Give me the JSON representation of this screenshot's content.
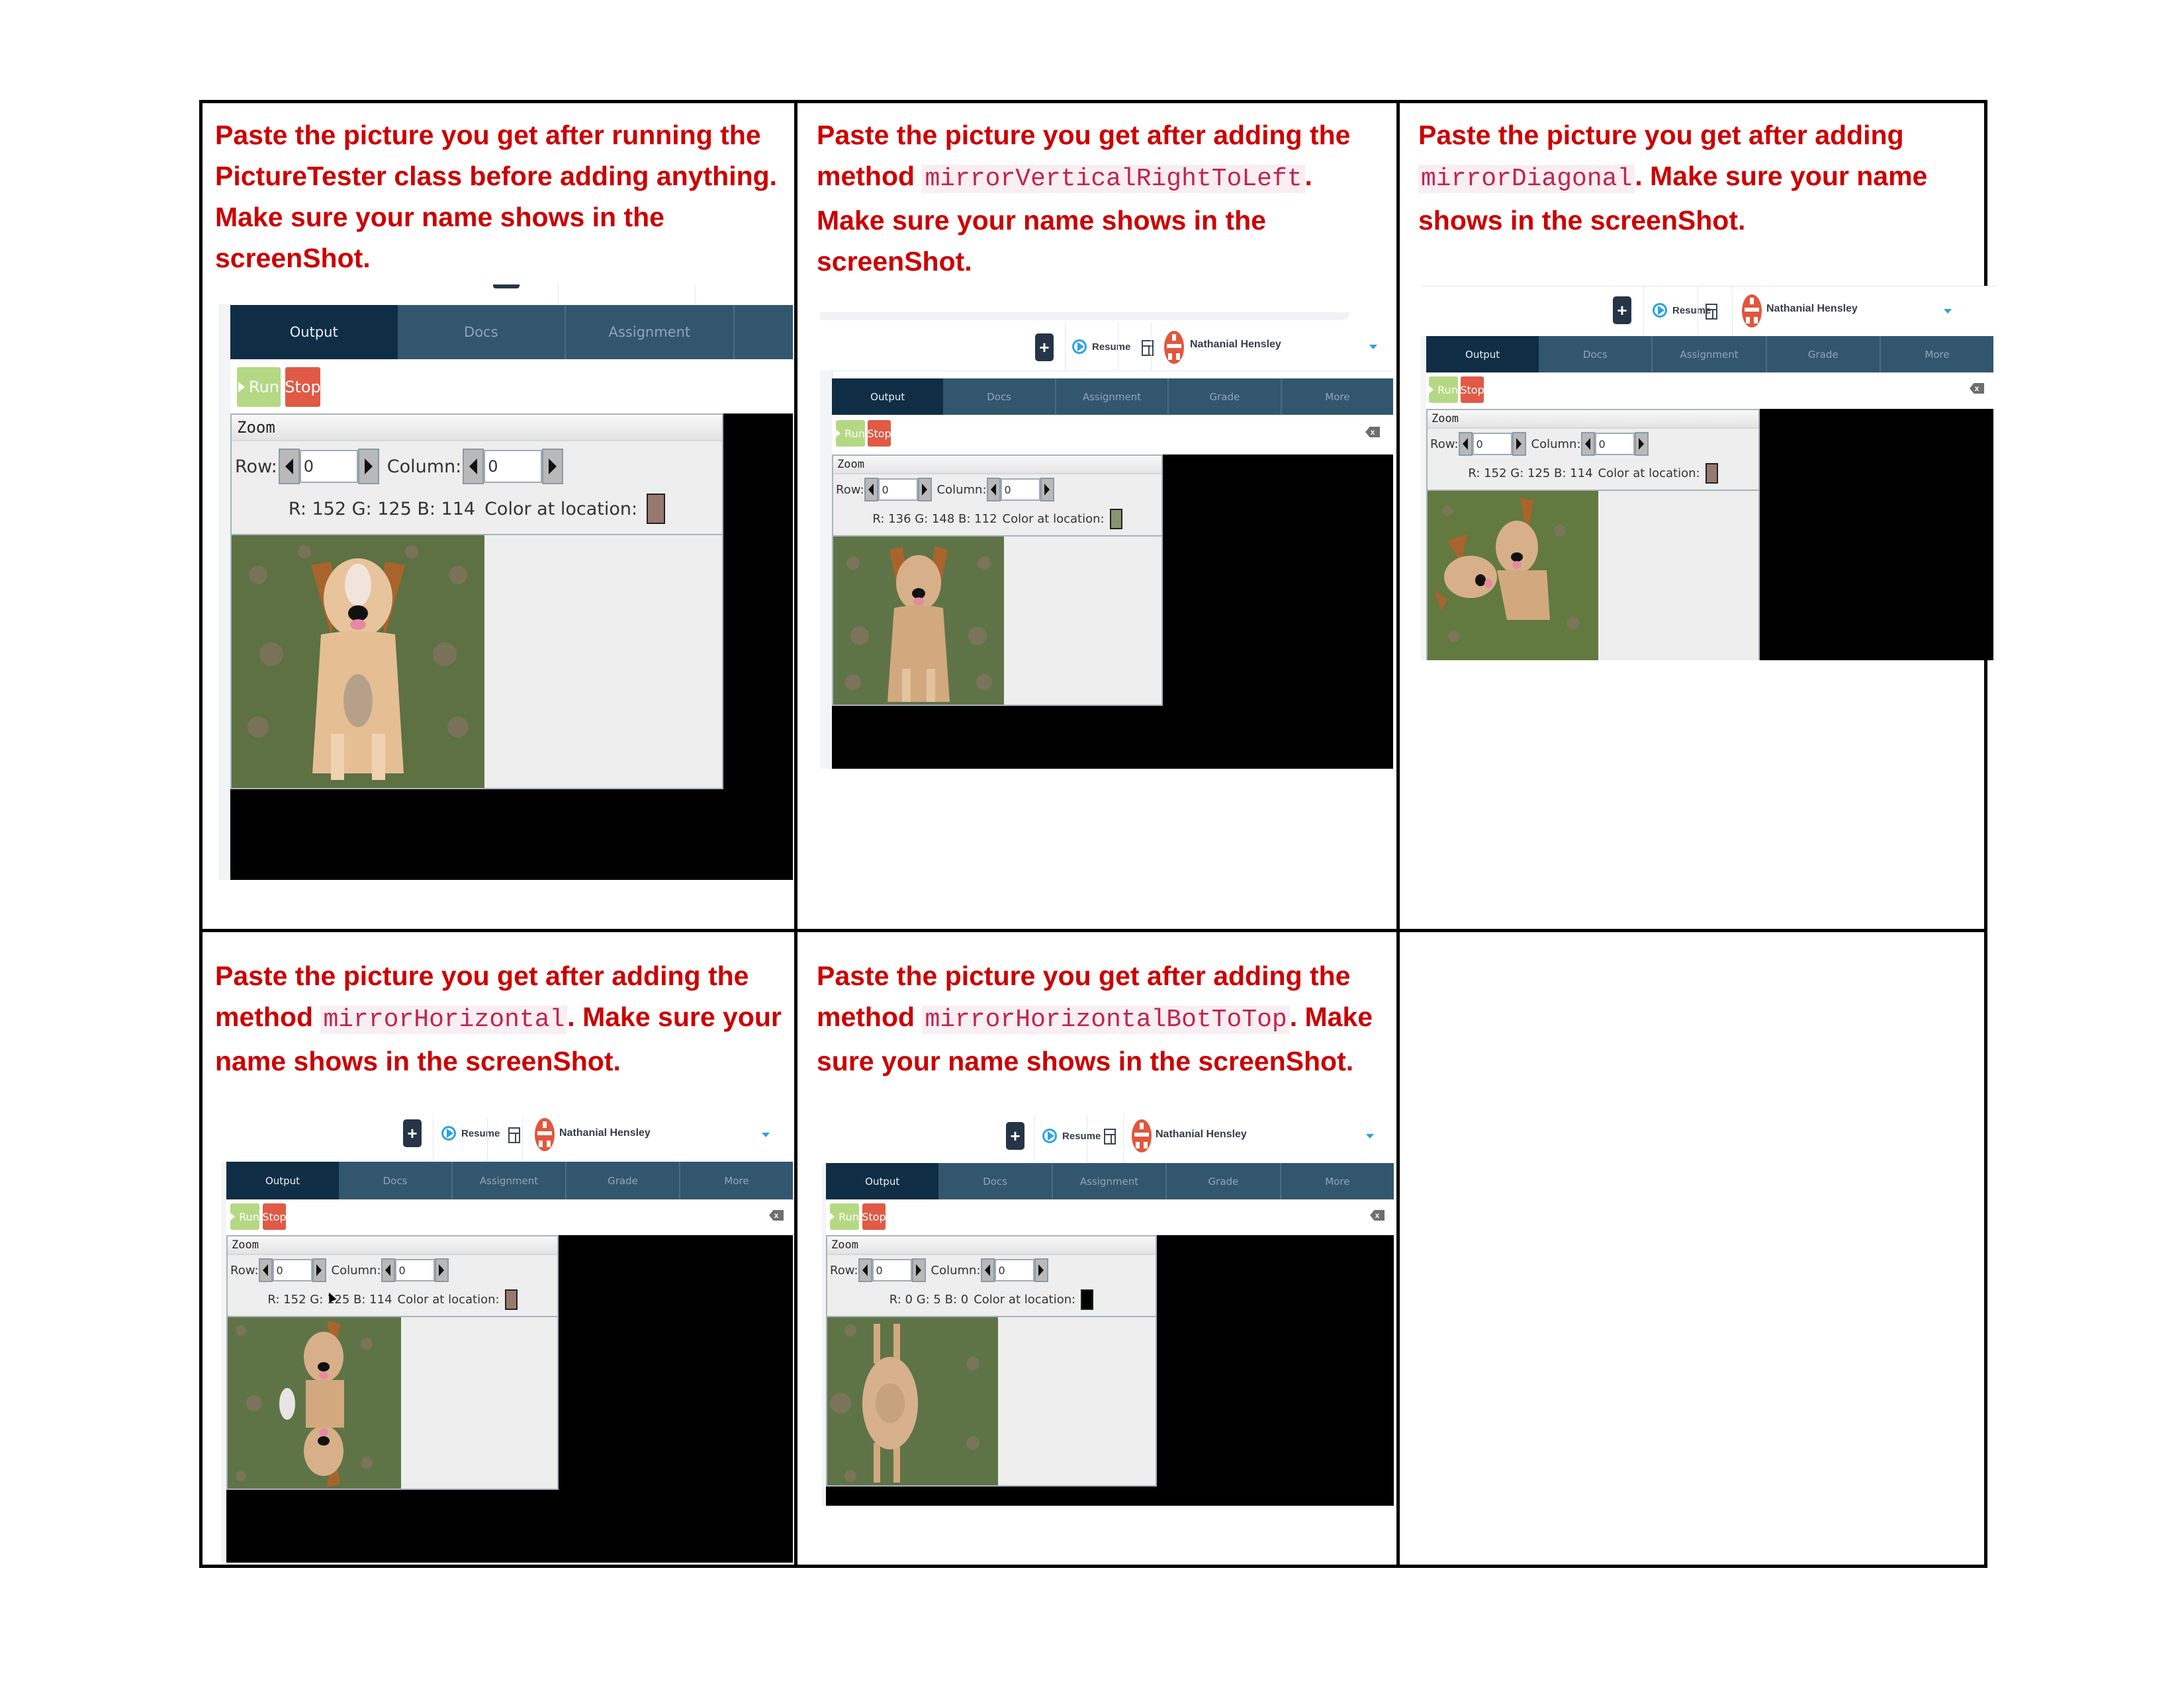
{
  "table": {
    "cells": [
      {
        "prompt_parts": [
          "Paste the picture you get after running the PictureTester class before adding anything. Make sure your name shows in the screenShot."
        ],
        "method": ""
      },
      {
        "prompt_before": "Paste the picture you get after adding the method ",
        "method": "mirrorVerticalRightToLeft",
        "prompt_after": ". Make sure your name shows in the screenShot."
      },
      {
        "prompt_before": "Paste the picture you get after adding ",
        "method": "mirrorDiagonal",
        "prompt_after": ".  Make sure your name shows in the screenShot."
      },
      {
        "prompt_before": "Paste the picture you get after adding the method ",
        "method": "mirrorHorizontal",
        "prompt_after": ".  Make sure your name shows in the screenShot."
      },
      {
        "prompt_before": "Paste the picture you get after adding the method ",
        "method": "mirrorHorizontalBotToTop",
        "prompt_after": ".  Make sure your name shows in the screenShot."
      },
      {
        "prompt_before": "",
        "method": "",
        "prompt_after": ""
      }
    ]
  },
  "app": {
    "add_button": "+",
    "resume_label": "Resume",
    "user_name": "Nathanial Hensley",
    "tabs_short": [
      "Output",
      "Docs",
      "Assignment"
    ],
    "tabs_full": [
      "Output",
      "Docs",
      "Assignment",
      "Grade",
      "More"
    ],
    "run_label": "Run",
    "stop_label": "Stop",
    "clear_label": "x",
    "zoom_title": "Zoom",
    "row_label": "Row:",
    "column_label": "Column:",
    "row_value": "0",
    "column_value": "0",
    "color_suffix": "Color at location:"
  },
  "screenshots": [
    {
      "rgb_text": "R: 152 G: 125 B: 114",
      "swatch": "#98796f",
      "image": "mirrored-vertical-dog"
    },
    {
      "rgb_text": "R: 136 G: 148 B: 112",
      "swatch": "#889470",
      "image": "mirror-vertical-right-to-left-dog"
    },
    {
      "rgb_text": "R: 152 G: 125 B: 114",
      "swatch": "#98796f",
      "image": "mirror-diagonal-dog"
    },
    {
      "rgb_text": "R: 152 G: 125 B: 114",
      "swatch": "#98796f",
      "image": "mirror-horizontal-dog"
    },
    {
      "rgb_text": "R: 0 G: 5 B: 0",
      "swatch": "#000500",
      "image": "mirror-horizontal-bot-to-top-dog"
    }
  ]
}
